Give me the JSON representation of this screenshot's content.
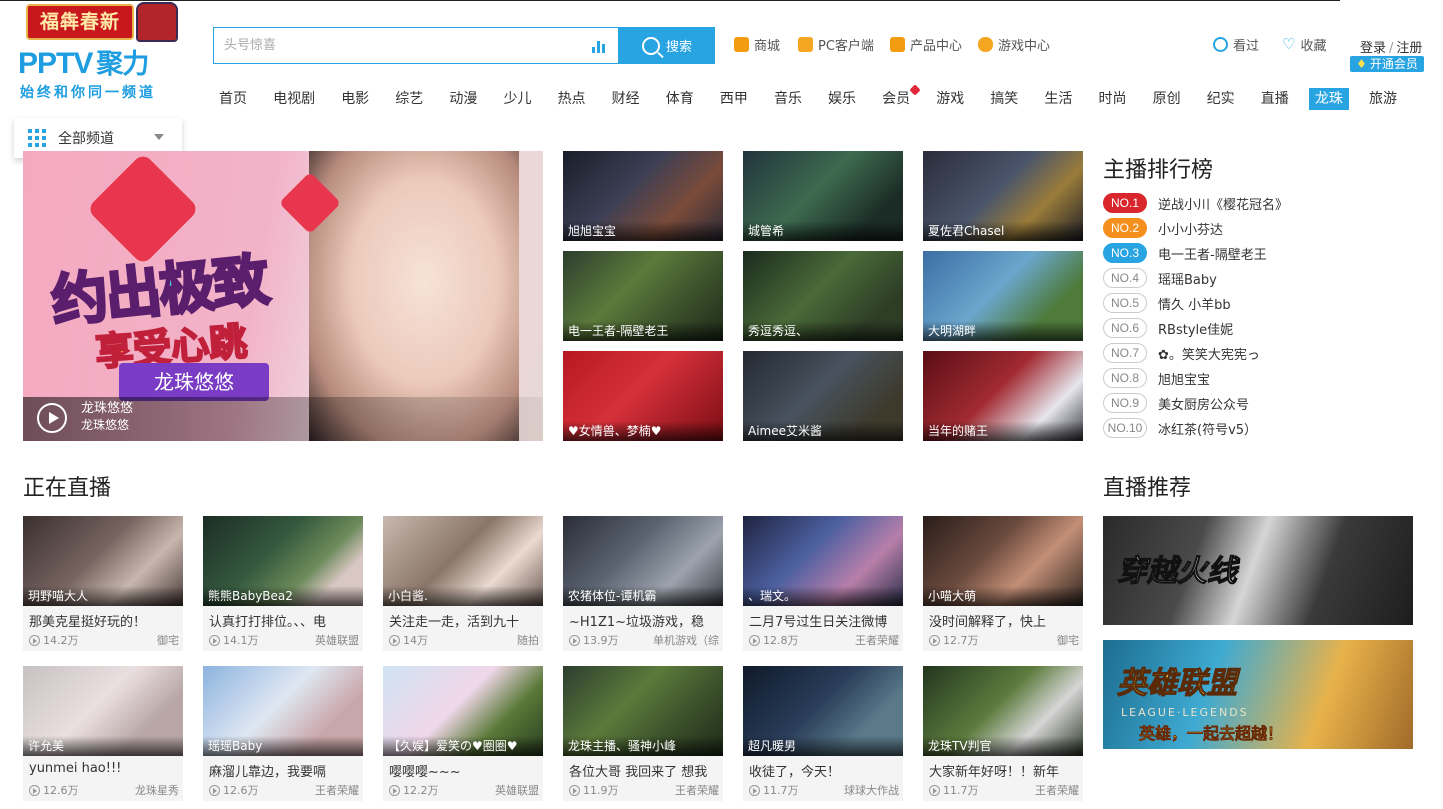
{
  "logo": {
    "banner": "福犇春新",
    "brand": "PPTV",
    "brand_cn": "聚力",
    "slogan": "始终和你同一频道"
  },
  "channel_menu": {
    "label": "全部频道"
  },
  "search": {
    "placeholder": "头号惊喜",
    "button": "搜索"
  },
  "quick_links": [
    "商城",
    "PC客户端",
    "产品中心",
    "游戏中心"
  ],
  "user": {
    "history": "看过",
    "favorites": "收藏",
    "login": "登录",
    "register": "注册",
    "vip": "开通会员"
  },
  "nav": [
    "首页",
    "电视剧",
    "电影",
    "综艺",
    "动漫",
    "少儿",
    "热点",
    "财经",
    "体育",
    "西甲",
    "音乐",
    "娱乐",
    "会员",
    "游戏",
    "搞笑",
    "生活",
    "时尚",
    "原创",
    "纪实",
    "直播",
    "龙珠",
    "旅游"
  ],
  "nav_active": "龙珠",
  "hero": {
    "title": "约出极致",
    "subtitle": "享受心跳",
    "ribbon": "龙珠悠悠",
    "caption1": "龙珠悠悠",
    "caption2": "龙珠悠悠"
  },
  "featured": [
    "旭旭宝宝",
    "城管希",
    "夏佐君Chasel",
    "电一王者-隔壁老王",
    "秀逗秀逗、",
    "大明湖畔",
    "♥女情兽、梦楠♥",
    "Aimee艾米酱",
    "当年的赌王"
  ],
  "ranking": {
    "title": "主播排行榜",
    "items": [
      {
        "rank": "NO.1",
        "name": "逆战小川《樱花冠名》"
      },
      {
        "rank": "NO.2",
        "name": "小小小芬达"
      },
      {
        "rank": "NO.3",
        "name": "电一王者-隔壁老王"
      },
      {
        "rank": "NO.4",
        "name": "瑶瑶Baby"
      },
      {
        "rank": "NO.5",
        "name": "情久 小羊bb"
      },
      {
        "rank": "NO.6",
        "name": "RBstyle佳妮"
      },
      {
        "rank": "NO.7",
        "name": "✿。笑笑大宪宪っ"
      },
      {
        "rank": "NO.8",
        "name": "旭旭宝宝"
      },
      {
        "rank": "NO.9",
        "name": "美女厨房公众号"
      },
      {
        "rank": "NO.10",
        "name": "冰红茶(符号v5）"
      }
    ]
  },
  "live_section": {
    "title": "正在直播"
  },
  "live": [
    {
      "caption": "玥野喵大人",
      "title": "那美克星挺好玩的！",
      "views": "14.2万",
      "category": "御宅"
    },
    {
      "caption": "熊熊BabyBea2",
      "title": "认真打打排位。、、电",
      "views": "14.1万",
      "category": "英雄联盟"
    },
    {
      "caption": "小白酱.",
      "title": "关注走一走，活到九十",
      "views": "14万",
      "category": "随拍"
    },
    {
      "caption": "农猪体位-谭机霸",
      "title": "~H1Z1~垃圾游戏，稳",
      "views": "13.9万",
      "category": "单机游戏（综"
    },
    {
      "caption": "、瑞文。",
      "title": "二月7号过生日关注微博",
      "views": "12.8万",
      "category": "王者荣耀"
    },
    {
      "caption": "小喵大萌",
      "title": "没时间解释了，快上",
      "views": "12.7万",
      "category": "御宅"
    },
    {
      "caption": "许允美",
      "title": "yunmei hao!!!",
      "views": "12.6万",
      "category": "龙珠星秀"
    },
    {
      "caption": "瑶瑶Baby",
      "title": "麻溜儿靠边，我要嗝",
      "views": "12.6万",
      "category": "王者荣耀"
    },
    {
      "caption": "【久娱】爱笑の♥圈圈♥",
      "title": "嘤嘤嘤~~~",
      "views": "12.2万",
      "category": "英雄联盟"
    },
    {
      "caption": "龙珠主播、骚神小峰",
      "title": "各位大哥 我回来了 想我",
      "views": "11.9万",
      "category": "王者荣耀"
    },
    {
      "caption": "超凡暖男",
      "title": "收徒了，今天！",
      "views": "11.7万",
      "category": "球球大作战"
    },
    {
      "caption": "龙珠TV判官",
      "title": "大家新年好呀！！新年",
      "views": "11.7万",
      "category": "王者荣耀"
    }
  ],
  "recommend": {
    "title": "直播推荐",
    "banners": [
      {
        "text": "穿越火线"
      },
      {
        "text": "英雄联盟",
        "sub": "LEAGUE·LEGENDS",
        "slogan": "英雄，一起去超越！"
      }
    ]
  }
}
